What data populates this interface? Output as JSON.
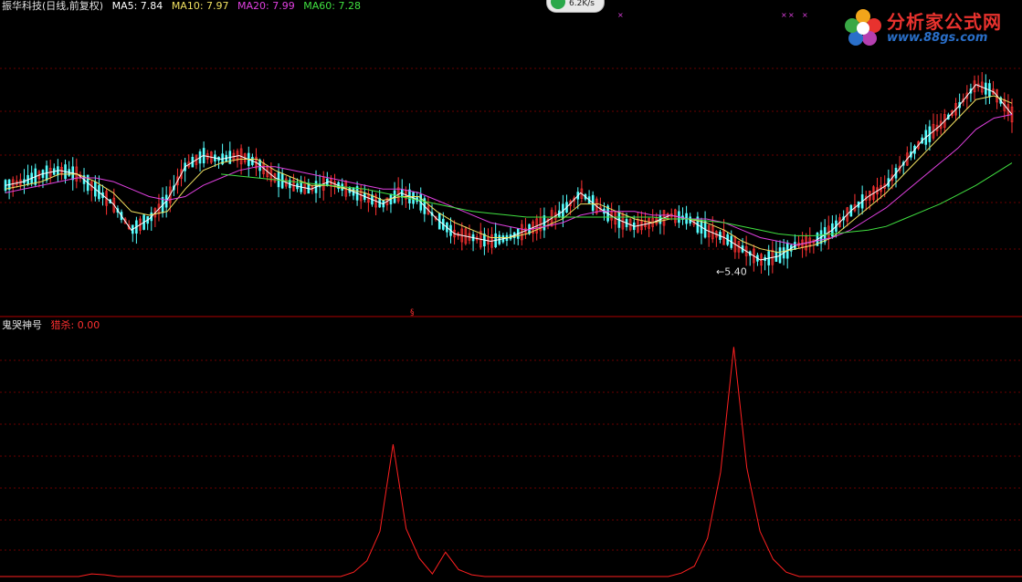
{
  "header": {
    "stock_title": "振华科技(日线,前复权)",
    "ma5": "MA5: 7.84",
    "ma10": "MA10: 7.97",
    "ma20": "MA20: 7.99",
    "ma60": "MA60: 7.28",
    "colors": {
      "title": "#e0e0e0",
      "ma5": "#ffffff",
      "ma10": "#f0e060",
      "ma20": "#e040e0",
      "ma60": "#40e040"
    }
  },
  "speed_badge": {
    "text": "6.2K/s"
  },
  "logo": {
    "text": "分析家公式网",
    "url": "www.88gs.com"
  },
  "low_marker": {
    "text": "←5.40"
  },
  "sub_header": {
    "indicator_name": "鬼哭神号",
    "line_label": "猎杀: 0.00",
    "colors": {
      "indicator": "#e0e0e0",
      "line": "#ff3030"
    }
  },
  "chart_data": [
    {
      "type": "candlestick",
      "title": "振华科技(日线,前复权)",
      "ylim": [
        4.6,
        11.2
      ],
      "low_annotation": 5.4,
      "series": [
        {
          "name": "MA5",
          "values": [
            7.7,
            7.8,
            8.0,
            8.1,
            8.0,
            7.6,
            7.2,
            6.5,
            6.8,
            7.3,
            8.2,
            8.5,
            8.4,
            8.5,
            8.3,
            7.9,
            7.7,
            7.6,
            7.8,
            7.6,
            7.4,
            7.2,
            7.5,
            7.3,
            6.8,
            6.4,
            6.3,
            6.2,
            6.3,
            6.5,
            6.7,
            7.0,
            7.5,
            7.1,
            6.8,
            6.6,
            6.7,
            6.9,
            6.8,
            6.5,
            6.3,
            6.0,
            5.7,
            5.8,
            6.1,
            6.2,
            6.5,
            7.0,
            7.4,
            7.7,
            8.3,
            8.9,
            9.3,
            9.8,
            10.4,
            10.2,
            9.6
          ]
        },
        {
          "name": "MA10",
          "values": [
            7.6,
            7.7,
            7.8,
            8.0,
            8.0,
            7.8,
            7.5,
            7.0,
            6.9,
            7.0,
            7.6,
            8.1,
            8.3,
            8.4,
            8.4,
            8.1,
            7.9,
            7.7,
            7.7,
            7.6,
            7.5,
            7.3,
            7.4,
            7.4,
            7.0,
            6.7,
            6.5,
            6.3,
            6.3,
            6.4,
            6.6,
            6.8,
            7.2,
            7.2,
            7.0,
            6.8,
            6.7,
            6.8,
            6.8,
            6.7,
            6.5,
            6.2,
            6.0,
            5.9,
            6.0,
            6.1,
            6.3,
            6.7,
            7.1,
            7.5,
            8.0,
            8.5,
            9.0,
            9.5,
            10.0,
            10.1,
            9.9
          ]
        },
        {
          "name": "MA20",
          "values": [
            7.5,
            7.6,
            7.7,
            7.8,
            7.9,
            7.9,
            7.8,
            7.6,
            7.4,
            7.3,
            7.4,
            7.7,
            7.9,
            8.1,
            8.2,
            8.2,
            8.1,
            8.0,
            7.9,
            7.8,
            7.7,
            7.6,
            7.6,
            7.5,
            7.3,
            7.1,
            6.9,
            6.7,
            6.6,
            6.5,
            6.6,
            6.7,
            6.9,
            7.0,
            7.0,
            7.0,
            6.9,
            6.9,
            6.8,
            6.8,
            6.7,
            6.5,
            6.3,
            6.2,
            6.1,
            6.2,
            6.3,
            6.5,
            6.8,
            7.1,
            7.5,
            7.9,
            8.3,
            8.7,
            9.2,
            9.5,
            9.6
          ]
        },
        {
          "name": "MA60",
          "values": [
            null,
            null,
            null,
            null,
            null,
            null,
            null,
            null,
            null,
            null,
            null,
            null,
            8.0,
            7.95,
            7.9,
            7.85,
            7.8,
            7.75,
            7.7,
            7.65,
            7.6,
            7.5,
            7.4,
            7.3,
            7.2,
            7.1,
            7.0,
            6.95,
            6.9,
            6.85,
            6.85,
            6.85,
            6.85,
            6.85,
            6.85,
            6.85,
            6.85,
            6.8,
            6.8,
            6.75,
            6.7,
            6.6,
            6.5,
            6.4,
            6.35,
            6.35,
            6.4,
            6.45,
            6.5,
            6.6,
            6.8,
            7.0,
            7.2,
            7.45,
            7.7,
            8.0,
            8.3
          ]
        }
      ]
    },
    {
      "type": "line",
      "title": "鬼哭神号",
      "series": [
        {
          "name": "猎杀",
          "values": [
            0,
            0,
            0,
            0,
            0,
            0,
            0,
            0.3,
            0.2,
            0,
            0,
            0,
            0,
            0,
            0,
            0,
            0,
            0,
            0,
            0,
            0,
            0,
            0,
            0,
            0,
            0,
            0,
            0.5,
            1.8,
            5.2,
            15.2,
            5.5,
            2.1,
            0.3,
            2.8,
            0.8,
            0.2,
            0,
            0,
            0,
            0,
            0,
            0,
            0,
            0,
            0,
            0,
            0,
            0,
            0,
            0,
            0,
            0.4,
            1.2,
            4.4,
            12.0,
            26.4,
            12.5,
            5.2,
            2.0,
            0.5,
            0,
            0,
            0,
            0,
            0,
            0,
            0,
            0,
            0,
            0,
            0,
            0,
            0,
            0,
            0,
            0,
            0,
            0
          ]
        }
      ],
      "ylim": [
        0,
        28
      ]
    }
  ]
}
